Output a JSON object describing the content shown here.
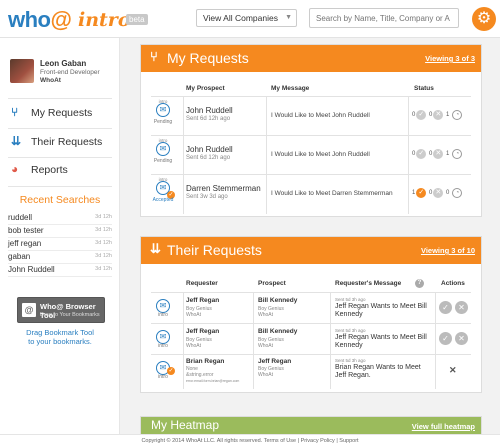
{
  "header": {
    "logo_main": "who",
    "logo_at": "@",
    "logo_intro": "intro",
    "beta_label": "beta",
    "company_select": "View All Companies",
    "search_placeholder": "Search by Name, Title, Company or A",
    "icons": {
      "gear": "gear-icon",
      "search": "search-icon"
    }
  },
  "user": {
    "name": "Leon Gaban",
    "role": "Front-end Developer",
    "company": "WhoAt"
  },
  "nav": [
    {
      "label": "My Requests",
      "icon": "fork-arrows-icon",
      "glyph": "⑂"
    },
    {
      "label": "Their Requests",
      "icon": "down-arrows-icon",
      "glyph": "⇊"
    },
    {
      "label": "Reports",
      "icon": "pie-chart-icon",
      "glyph": "◕"
    }
  ],
  "recent": {
    "title": "Recent Searches",
    "items": [
      {
        "name": "ruddell",
        "date": "3d 12h"
      },
      {
        "name": "bob tester",
        "date": "3d 12h"
      },
      {
        "name": "jeff regan",
        "date": "3d 12h"
      },
      {
        "name": "gaban",
        "date": "3d 12h"
      },
      {
        "name": "John Ruddell",
        "date": "3d 12h"
      }
    ]
  },
  "tool": {
    "title": "Who@ Browser Tool",
    "subtitle": "Drag to Your Bookmarks",
    "drag_line1": "Drag Bookmark Tool",
    "drag_line2": "to your bookmarks."
  },
  "my_requests": {
    "title": "My Requests",
    "viewing": "Viewing 3 of 3",
    "columns": {
      "prospect": "My Prospect",
      "message": "My Message",
      "status": "Status"
    },
    "rows": [
      {
        "badge_top": "intro",
        "state": "Pending",
        "name": "John Ruddell",
        "sent": "Sent 6d 12h ago",
        "message": "I Would Like to Meet John Ruddell",
        "count_a": "0",
        "count_b": "0",
        "count_c": "1",
        "accepted": false
      },
      {
        "badge_top": "intro",
        "state": "Pending",
        "name": "John Ruddell",
        "sent": "Sent 6d 12h ago",
        "message": "I Would Like to Meet John Ruddell",
        "count_a": "0",
        "count_b": "0",
        "count_c": "1",
        "accepted": false
      },
      {
        "badge_top": "intro",
        "state": "Accepted",
        "name": "Darren Stemmerman",
        "sent": "Sent 3w 3d ago",
        "message": "I Would Like to Meet Darren Stemmerman",
        "count_a": "1",
        "count_b": "0",
        "count_c": "0",
        "accepted": true
      }
    ]
  },
  "their_requests": {
    "title": "Their Requests",
    "viewing": "Viewing 3 of 10",
    "columns": {
      "requester": "Requester",
      "prospect": "Prospect",
      "message": "Requester's Message",
      "actions": "Actions"
    },
    "rows": [
      {
        "badge_top": "intro",
        "req_name": "Jeff Regan",
        "req_l1": "Boy Genius",
        "req_l2": "WhoAt",
        "pros_name": "Bill Kennedy",
        "pros_l1": "Boy Genius",
        "pros_l2": "WhoAt",
        "sent": "Sent 5d 3h ago",
        "message": "Jeff Regan Wants to Meet Bill Kennedy"
      },
      {
        "badge_top": "intro",
        "req_name": "Jeff Regan",
        "req_l1": "Boy Genius",
        "req_l2": "WhoAt",
        "pros_name": "Bill Kennedy",
        "pros_l1": "Boy Genius",
        "pros_l2": "WhoAt",
        "sent": "Sent 5d 3h ago",
        "message": "Jeff Regan Wants to Meet Bill Kennedy"
      },
      {
        "badge_top": "intro",
        "req_name": "Brian Regan",
        "req_l1": "None",
        "req_l2": "&string.error",
        "req_l3": "error.email.form.brian@regan.com",
        "pros_name": "Jeff Regan",
        "pros_l1": "Boy Genius",
        "pros_l2": "WhoAt",
        "sent": "Sent 5d 3h ago",
        "message": "Brian Regan Wants to Meet Jeff Regan."
      }
    ]
  },
  "heatmap": {
    "title": "My Heatmap",
    "link": "View full heatmap"
  },
  "footer": {
    "text": "Copyright © 2014 WhoAt LLC. All rights reserved. Terms of Use | Privacy Policy | Support"
  },
  "colors": {
    "orange": "#f5891f",
    "blue": "#2a7fc0",
    "green": "#9bbb5c"
  }
}
